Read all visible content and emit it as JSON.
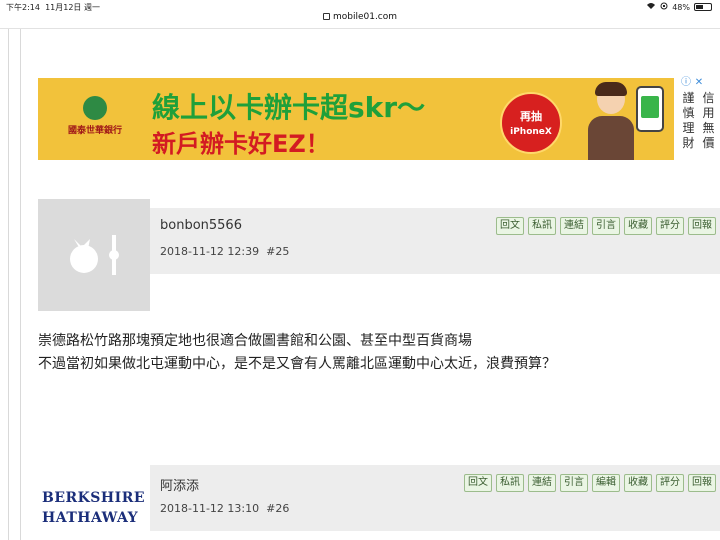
{
  "status_bar": {
    "time": "下午2:14",
    "date": "11月12日 週一",
    "battery_percent": "48%",
    "battery_level": 0.48
  },
  "browser": {
    "url": "mobile01.com"
  },
  "ad": {
    "bank_name": "國泰世華銀行",
    "headline": "線上以卡辦卡超skr～",
    "subline": "新戶辦卡好EZ！",
    "badge_top": "再抽",
    "badge_bottom": "iPhoneX",
    "side_text": [
      "謹慎理財",
      "信用無價"
    ]
  },
  "posts": [
    {
      "username": "bonbon5566",
      "datetime": "2018-11-12 12:39",
      "floor": "#25",
      "actions": [
        "回文",
        "私訊",
        "連結",
        "引言",
        "收藏",
        "評分",
        "回報"
      ],
      "lines": [
        "崇德路松竹路那塊預定地也很適合做圖書館和公園、甚至中型百貨商場",
        "不過當初如果做北屯運動中心，是不是又會有人罵離北區運動中心太近，浪費預算？"
      ]
    },
    {
      "username": "阿添添",
      "datetime": "2018-11-12 13:10",
      "floor": "#26",
      "actions": [
        "回文",
        "私訊",
        "連結",
        "引言",
        "編輯",
        "收藏",
        "評分",
        "回報"
      ],
      "avatar_logo": [
        "BERKSHIRE",
        "HATHAWAY"
      ]
    }
  ]
}
